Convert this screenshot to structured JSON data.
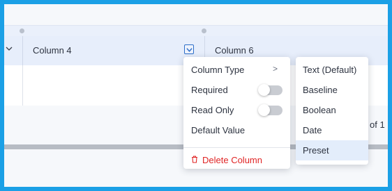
{
  "table": {
    "columns": [
      {
        "label": ""
      },
      {
        "label": "Column 4"
      },
      {
        "label": "Column 6"
      }
    ],
    "pagination_text": "of 1"
  },
  "context_menu": {
    "items": [
      {
        "label": "Column Type",
        "has_submenu": true
      },
      {
        "label": "Required",
        "toggle": false
      },
      {
        "label": "Read Only",
        "toggle": false
      },
      {
        "label": "Default Value"
      },
      {
        "label": "Delete Column",
        "danger": true
      }
    ],
    "submenu_arrow": ">"
  },
  "column_type_submenu": {
    "items": [
      {
        "label": "Text (Default)"
      },
      {
        "label": "Baseline"
      },
      {
        "label": "Boolean"
      },
      {
        "label": "Date"
      },
      {
        "label": "Preset",
        "highlighted": true
      }
    ]
  },
  "icons": {
    "left_chevron": "chevron-down-icon",
    "column_dropdown": "chevron-down-icon",
    "delete": "trash-icon"
  },
  "colors": {
    "frame": "#1ba0e6",
    "header_bg": "#e7eefb",
    "danger": "#e02424",
    "highlight": "#e3edfb",
    "accent": "#2c6ec9"
  }
}
